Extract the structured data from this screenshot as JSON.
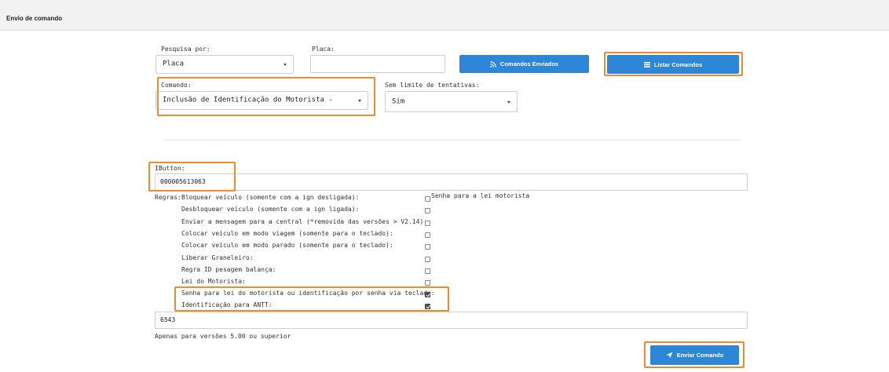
{
  "header": {
    "title": "Envio de comando"
  },
  "search_by": {
    "label": "Pesquisa por:",
    "value": "Placa"
  },
  "plate": {
    "label": "Placa:",
    "value": ""
  },
  "buttons": {
    "sent_commands": "Comandos Enviados",
    "list_commands": "Listar Comandos",
    "send_command": "Enviar Comando"
  },
  "command": {
    "label": "Comando:",
    "value": "Inclusão de Identificação do Motorista -"
  },
  "retry_limit": {
    "label": "Sem limite de tentativas:",
    "value": "Sim"
  },
  "ibutton": {
    "label": "IButton:",
    "value": "000005613063"
  },
  "rules": {
    "label": "Regras:",
    "items": [
      {
        "label": "Bloquear veículo (somente com a ign desligada):",
        "checked": false
      },
      {
        "label": "Desbloquear veículo (somente com a ign ligada):",
        "checked": false
      },
      {
        "label": "Enviar a mensagem para a central (*removida das versões > V2.14):",
        "checked": false
      },
      {
        "label": "Colocar veículo em modo viagem (somente para o teclado):",
        "checked": false
      },
      {
        "label": "Colocar veículo em modo parado (somente para o teclado):",
        "checked": false
      },
      {
        "label": "Liberar Graneleiro:",
        "checked": false
      },
      {
        "label": "Regra ID pesagem balança:",
        "checked": false
      },
      {
        "label": "Lei do Motorista:",
        "checked": false
      },
      {
        "label": "Senha para lei do motorista ou identificação por senha via teclado:",
        "checked": true
      },
      {
        "label": "Identificação para ANTT:",
        "checked": true
      }
    ],
    "side_option": "Senha para a lei motorista"
  },
  "password": {
    "value": "6543",
    "note": "Apenas para versões 5.00 ou superior"
  },
  "colors": {
    "primary": "#2e86d6",
    "highlight": "#ef8a2e"
  }
}
